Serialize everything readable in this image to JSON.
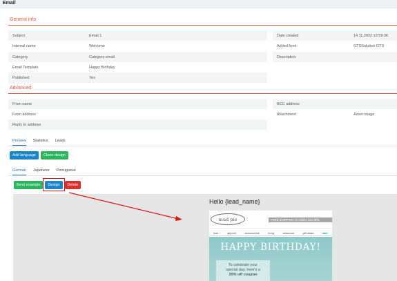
{
  "window": {
    "title": "Email"
  },
  "general_info": {
    "title": "General info",
    "left": [
      {
        "label": "Subject",
        "value": "Email 1"
      },
      {
        "label": "Internal name",
        "value": "Welcome"
      },
      {
        "label": "Category",
        "value": "Category email"
      },
      {
        "label": "Email Template",
        "value": "Happy Birthday"
      },
      {
        "label": "Published",
        "value": "Yes"
      }
    ],
    "right": [
      {
        "label": "Date created",
        "value": "14.11.2022 10:59:36"
      },
      {
        "label": "Added from",
        "value": "GTSSolution GTS"
      },
      {
        "label": "Description",
        "value": ""
      }
    ]
  },
  "advanced": {
    "title": "Advanced",
    "left": [
      {
        "label": "From name",
        "value": ""
      },
      {
        "label": "From address",
        "value": ""
      },
      {
        "label": "Reply to address",
        "value": ""
      }
    ],
    "right": [
      {
        "label": "BCC address",
        "value": ""
      },
      {
        "label": "Attachment",
        "value": "Asset image"
      }
    ]
  },
  "main_tabs": [
    "Preview",
    "Statistics",
    "Leads"
  ],
  "buttons": {
    "add_language": "Add language",
    "clone_design": "Clone design",
    "send_example": "Send example",
    "design": "Design",
    "delete": "Delete"
  },
  "language_tabs": [
    "German",
    "Japanese",
    "Portuguese"
  ],
  "preview": {
    "greeting": "Hello {lead_name}",
    "logo": "mud pie",
    "shipping": "FREE SHIPPING on orders over $75",
    "categories": [
      "kids",
      "apparel",
      "accessories",
      "living",
      "seasonal",
      "gift ideas",
      "sale"
    ],
    "headline": "HAPPY BIRTHDAY!",
    "card_lines": [
      "To celebrate your",
      "special day, here's a",
      "20% off coupon"
    ]
  },
  "colors": {
    "accent": "#e0583a",
    "primary": "#1a86c7",
    "success": "#2db55d",
    "danger": "#d9302f",
    "annotation": "#dd1111"
  }
}
